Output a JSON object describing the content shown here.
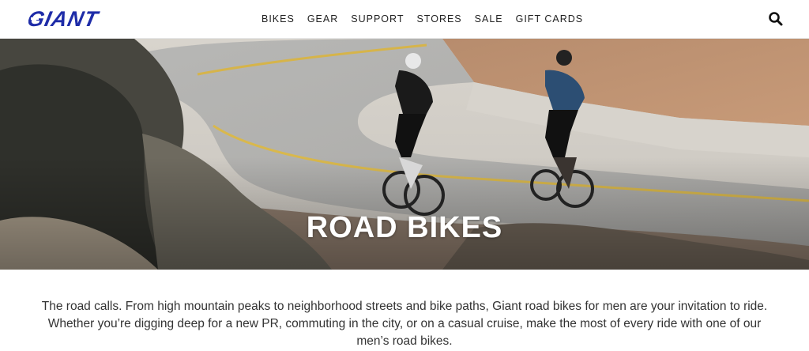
{
  "brand": {
    "logo_text": "GIANT",
    "logo_color": "#1e2ca8"
  },
  "nav": {
    "items": [
      "BIKES",
      "GEAR",
      "SUPPORT",
      "STORES",
      "SALE",
      "GIFT CARDS"
    ]
  },
  "header": {
    "search_icon": "search-icon"
  },
  "hero": {
    "title": "ROAD BIKES"
  },
  "intro": {
    "lines": [
      "The road calls. From high mountain peaks to neighborhood streets and bike paths, Giant road bikes for men are your invitation to ride.",
      "Whether you’re digging deep for a new PR, commuting in the city, or on a casual cruise, make the most of every ride with one of our",
      "men’s road bikes."
    ]
  }
}
